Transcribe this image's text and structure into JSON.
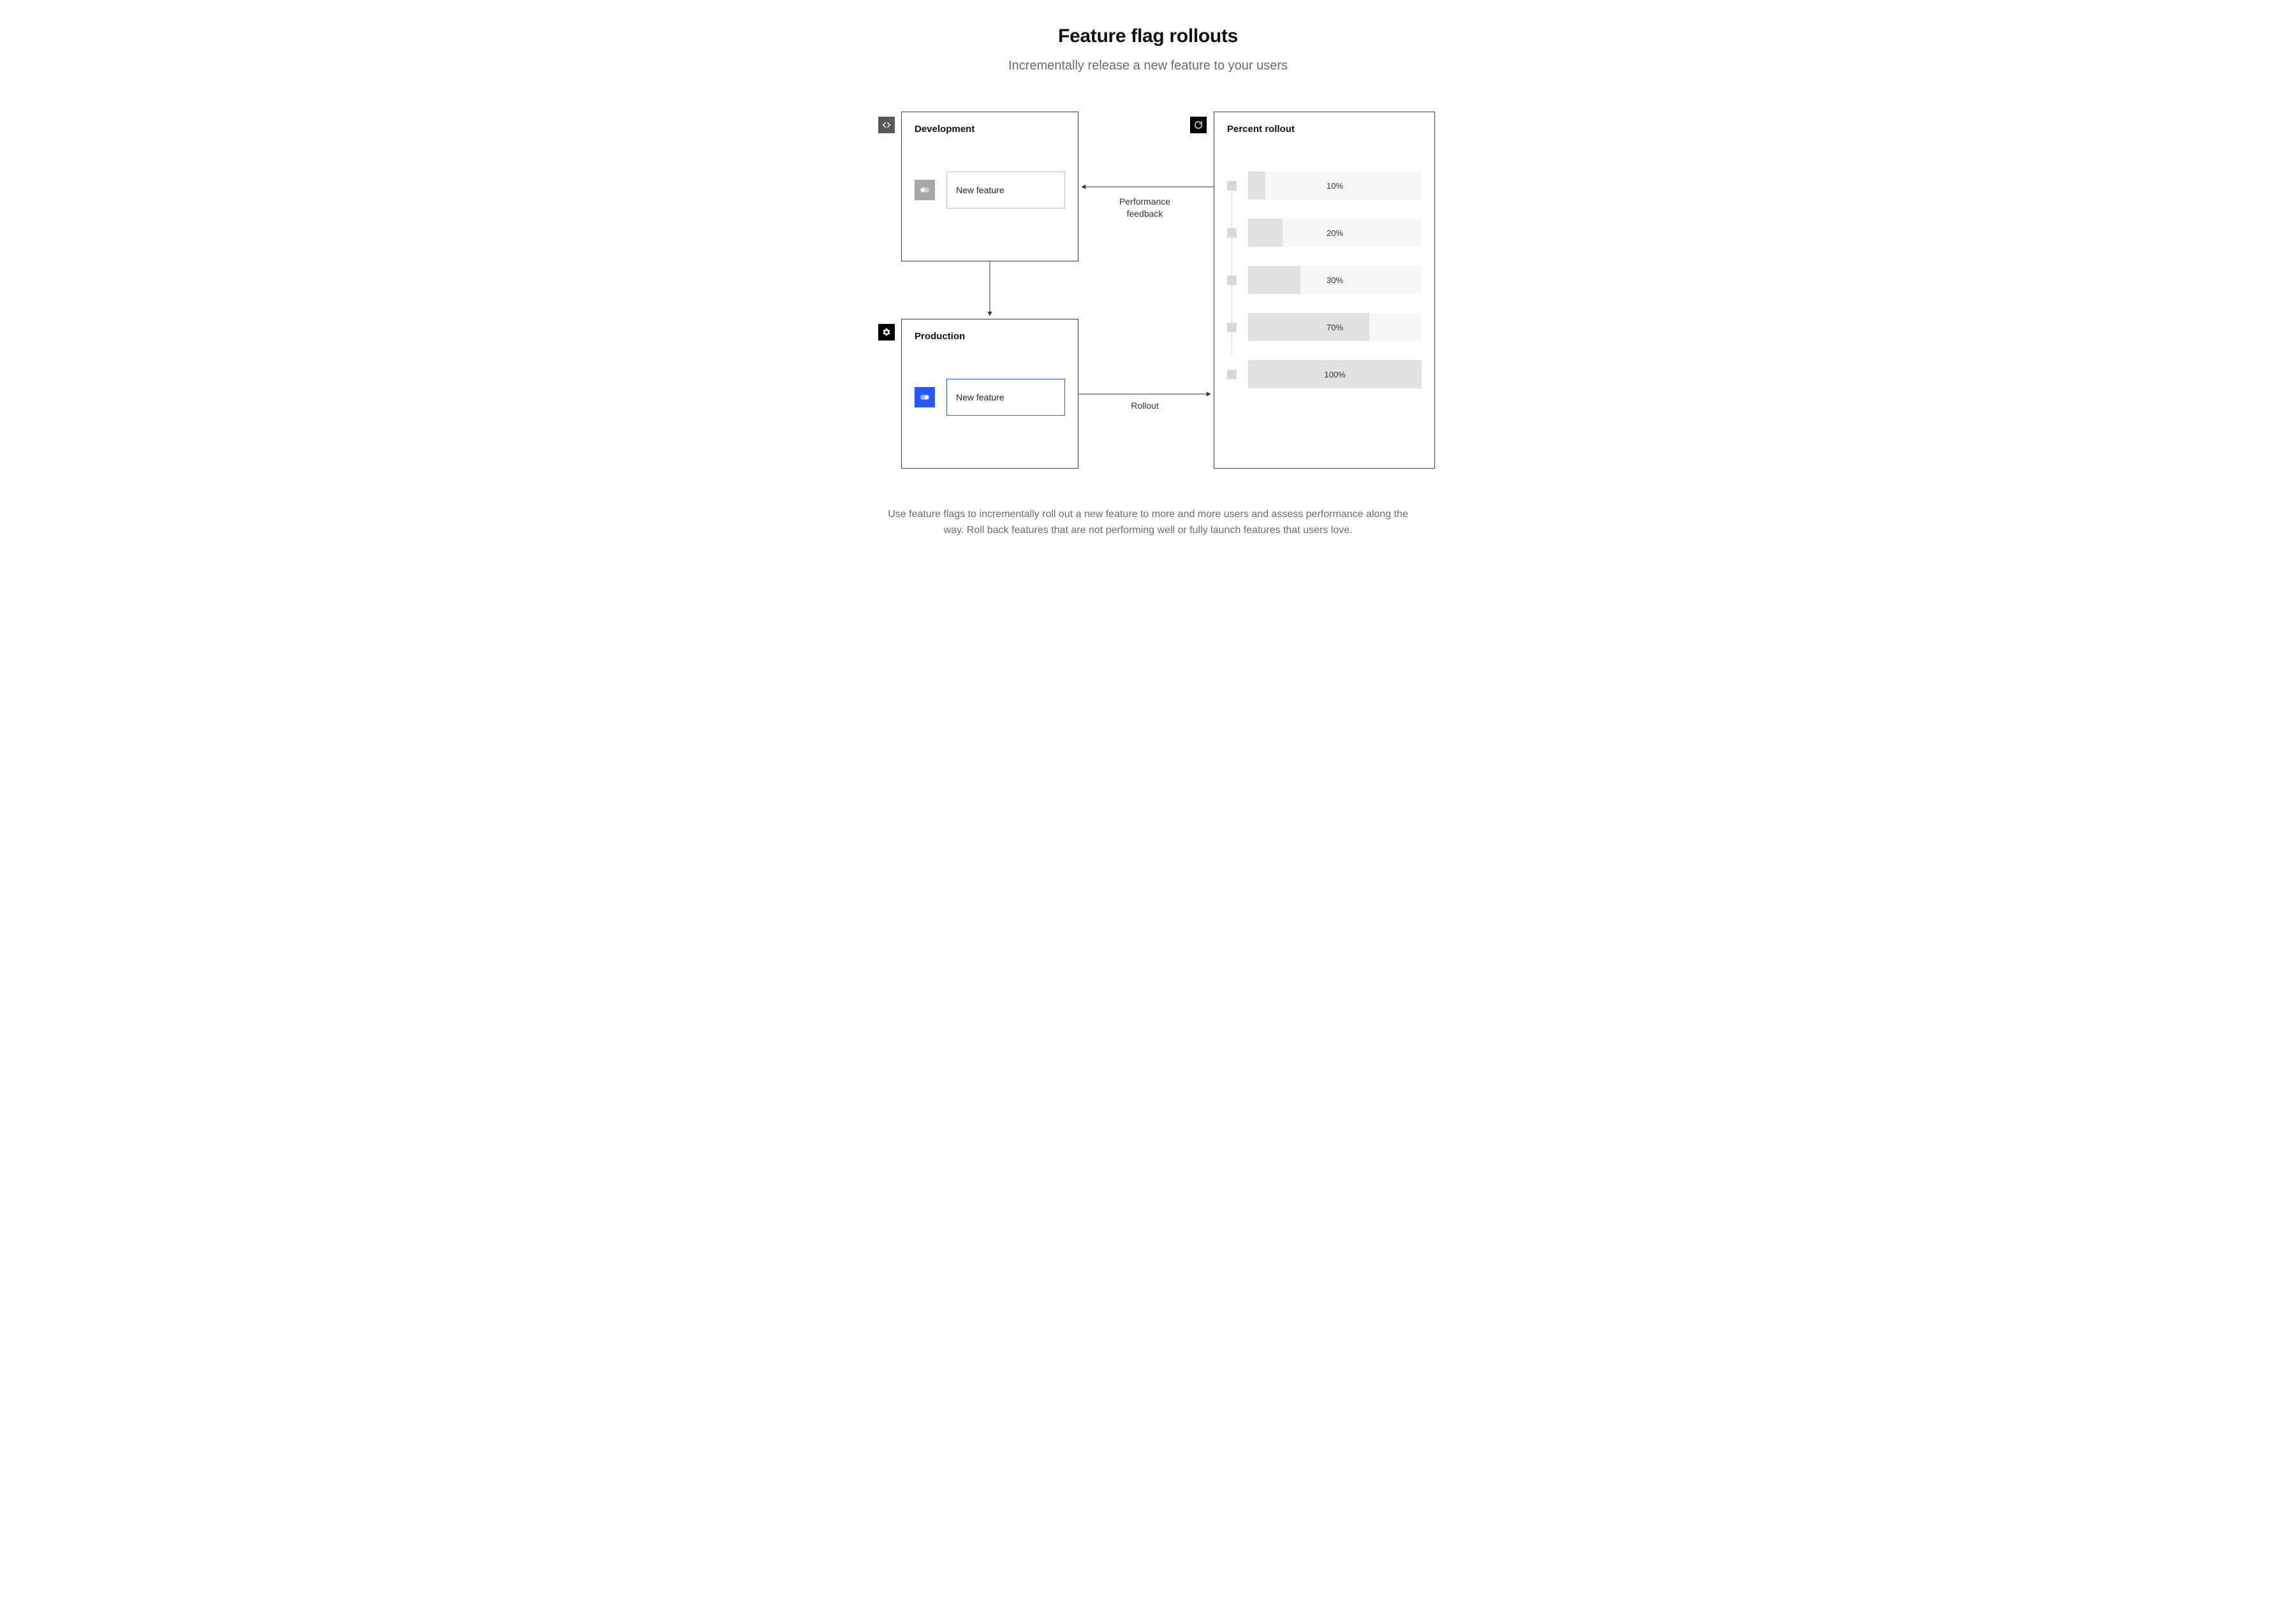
{
  "title": "Feature flag rollouts",
  "subtitle": "Incrementally release a new feature to your users",
  "development": {
    "heading": "Development",
    "feature_label": "New feature"
  },
  "production": {
    "heading": "Production",
    "feature_label": "New feature"
  },
  "rollout": {
    "heading": "Percent rollout",
    "steps": [
      "10%",
      "20%",
      "30%",
      "70%",
      "100%"
    ],
    "step_values": [
      10,
      20,
      30,
      70,
      100
    ]
  },
  "arrows": {
    "feedback_label": "Performance\nfeedback",
    "rollout_label": "Rollout"
  },
  "footer": "Use feature flags to incrementally roll out a new feature to more and more users and assess performance along the way. Roll back features that are not performing well or fully launch features that users love.",
  "colors": {
    "accent_blue": "#2558ff",
    "panel_border": "#3a3a3a",
    "muted_text": "#6b6b6b"
  }
}
